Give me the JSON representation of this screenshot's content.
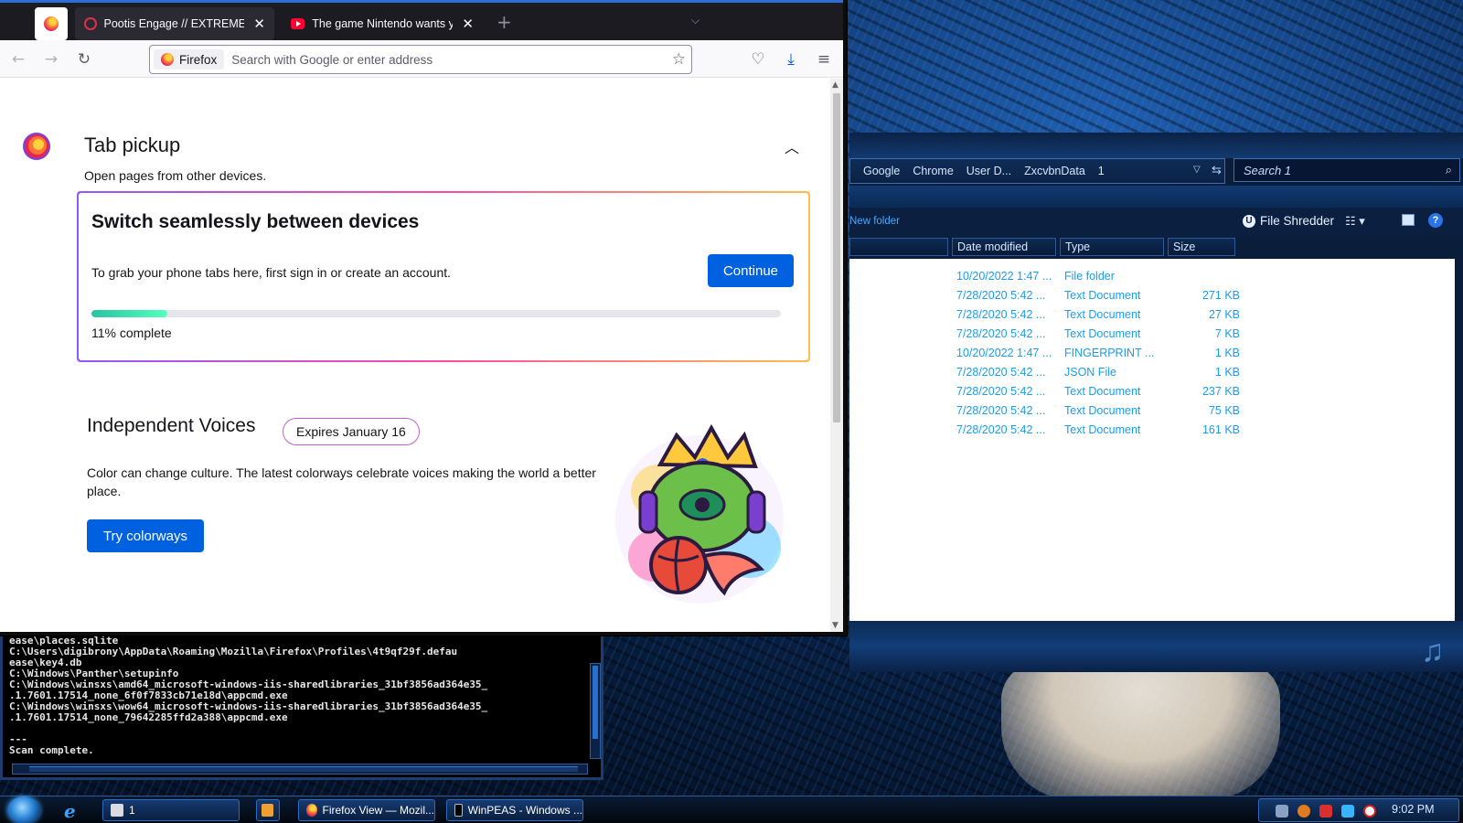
{
  "firefox": {
    "tabs": [
      {
        "label": "Pootis Engage // EXTREME: Int",
        "close": "✕"
      },
      {
        "label": "The game Nintendo wants you",
        "close": "✕"
      }
    ],
    "new_tab": "+",
    "tab_list": "⌵",
    "url_identity": "Firefox",
    "url_placeholder": "Search with Google or enter address",
    "tab_pickup": {
      "title": "Tab pickup",
      "subtitle": "Open pages from other devices.",
      "card_heading": "Switch seamlessly between devices",
      "card_body": "To grab your phone tabs here, first sign in or create an account.",
      "continue_label": "Continue",
      "progress_fraction": 0.11,
      "progress_text": "11% complete"
    },
    "independent_voices": {
      "title": "Independent Voices",
      "badge": "Expires January 16",
      "description": "Color can change culture. The latest colorways celebrate voices making the world a better place.",
      "button_label": "Try colorways"
    }
  },
  "explorer": {
    "breadcrumbs": [
      "Google",
      "Chrome",
      "User D...",
      "ZxcvbnData",
      "1"
    ],
    "search_placeholder": "Search 1",
    "new_folder_label": "New folder",
    "shredder_label": "File Shredder",
    "columns": [
      "Date modified",
      "Type",
      "Size"
    ],
    "files": [
      {
        "date": "10/20/2022 1:47 ...",
        "type": "File folder",
        "size": ""
      },
      {
        "date": "7/28/2020 5:42 ...",
        "type": "Text Document",
        "size": "271 KB"
      },
      {
        "date": "7/28/2020 5:42 ...",
        "type": "Text Document",
        "size": "27 KB"
      },
      {
        "date": "7/28/2020 5:42 ...",
        "type": "Text Document",
        "size": "7 KB"
      },
      {
        "date": "10/20/2022 1:47 ...",
        "type": "FINGERPRINT ...",
        "size": "1 KB"
      },
      {
        "date": "7/28/2020 5:42 ...",
        "type": "JSON File",
        "size": "1 KB"
      },
      {
        "date": "7/28/2020 5:42 ...",
        "type": "Text Document",
        "size": "237 KB"
      },
      {
        "date": "7/28/2020 5:42 ...",
        "type": "Text Document",
        "size": "75 KB"
      },
      {
        "date": "7/28/2020 5:42 ...",
        "type": "Text Document",
        "size": "161 KB"
      }
    ]
  },
  "console": {
    "lines": [
      "ease\\places.sqlite",
      "C:\\Users\\digibrony\\AppData\\Roaming\\Mozilla\\Firefox\\Profiles\\4t9qf29f.defau",
      "ease\\key4.db",
      "C:\\Windows\\Panther\\setupinfo",
      "C:\\Windows\\winsxs\\amd64_microsoft-windows-iis-sharedlibraries_31bf3856ad364e35_",
      ".1.7601.17514_none_6f0f7833cb71e18d\\appcmd.exe",
      "C:\\Windows\\winsxs\\wow64_microsoft-windows-iis-sharedlibraries_31bf3856ad364e35_",
      ".1.7601.17514_none_79642285ffd2a388\\appcmd.exe",
      "",
      "---",
      "Scan complete."
    ]
  },
  "taskbar": {
    "items": [
      {
        "label": "1"
      },
      {
        "label": "Firefox View — Mozil..."
      },
      {
        "label": "WinPEAS - Windows ..."
      }
    ],
    "clock": "9:02 PM"
  },
  "colors": {
    "accent_blue": "#0061e0",
    "progress_green": "#2ac3a2",
    "explorer_link": "#1a9cf0"
  }
}
